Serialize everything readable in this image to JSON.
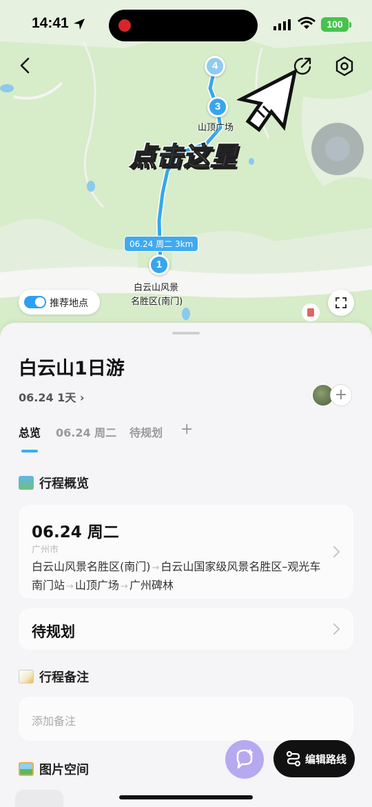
{
  "status_bar": {
    "time": "14:41",
    "battery": "100"
  },
  "map": {
    "stops": [
      {
        "number": "4",
        "label": ""
      },
      {
        "number": "3",
        "label": "山顶广场"
      },
      {
        "number": "1",
        "label": "白云山风景\n名胜区(南门)"
      }
    ],
    "stop1_label_line1": "白云山风景",
    "stop1_label_line2": "名胜区(南门)",
    "distance_tag": "06.24 周二 3km",
    "overlay_caption": [
      "点",
      "击",
      "这",
      "里"
    ],
    "recommend_toggle_label": "推荐地点",
    "recommend_toggle_on": true
  },
  "trip": {
    "title": "白云山1日游",
    "meta": "06.24 1天 ›"
  },
  "tabs": [
    {
      "label": "总览",
      "active": true
    },
    {
      "label": "06.24 周二",
      "active": false
    },
    {
      "label": "待规划",
      "active": false
    },
    {
      "label": "+",
      "active": false
    }
  ],
  "sections": {
    "overview_title": "行程概览",
    "notes_title": "行程备注",
    "photos_title": "图片空间"
  },
  "day_card": {
    "date": "06.24 周二",
    "city": "广州市",
    "route": [
      "白云山风景名胜区(南门)",
      "白云山国家级风景名胜区–观光车南门站",
      "山顶广场",
      "广州碑林"
    ]
  },
  "pending_card": {
    "label": "待规划"
  },
  "notes": {
    "placeholder": "添加备注"
  },
  "actions": {
    "edit_route": "编辑路线"
  },
  "colors": {
    "accent": "#36a6ec",
    "map_green": "#d7ecc9",
    "ai_button": "#b7a9ef"
  }
}
